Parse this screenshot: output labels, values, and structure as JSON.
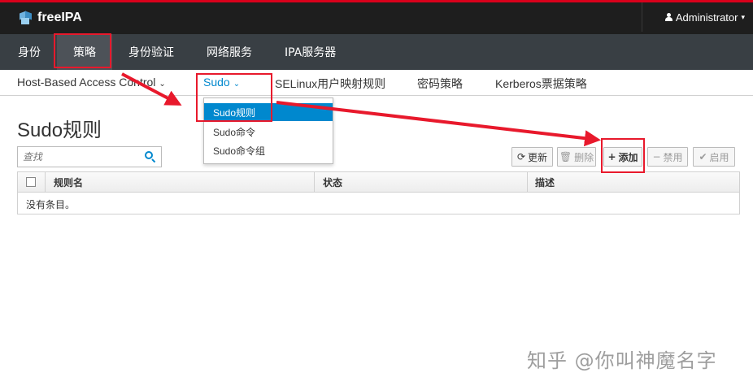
{
  "header": {
    "brand": "freeIPA",
    "user": "Administrator"
  },
  "main_nav": [
    {
      "label": "身份"
    },
    {
      "label": "策略"
    },
    {
      "label": "身份验证"
    },
    {
      "label": "网络服务"
    },
    {
      "label": "IPA服务器"
    }
  ],
  "sub_nav": [
    {
      "label": "Host-Based Access Control"
    },
    {
      "label": "Sudo"
    },
    {
      "label": "SELinux用户映射规则"
    },
    {
      "label": "密码策略"
    },
    {
      "label": "Kerberos票据策略"
    }
  ],
  "dropdown": {
    "items": [
      {
        "label": "Sudo规则"
      },
      {
        "label": "Sudo命令"
      },
      {
        "label": "Sudo命令组"
      }
    ]
  },
  "page": {
    "title": "Sudo规则"
  },
  "search": {
    "placeholder": "查找"
  },
  "actions": {
    "refresh": "更新",
    "delete": "删除",
    "add": "添加",
    "disable": "禁用",
    "enable": "启用"
  },
  "table": {
    "columns": [
      "规则名",
      "状态",
      "描述"
    ],
    "empty_message": "没有条目。"
  },
  "annotation": {
    "color": "#e8192c"
  },
  "watermark": "知乎 @你叫神魔名字"
}
